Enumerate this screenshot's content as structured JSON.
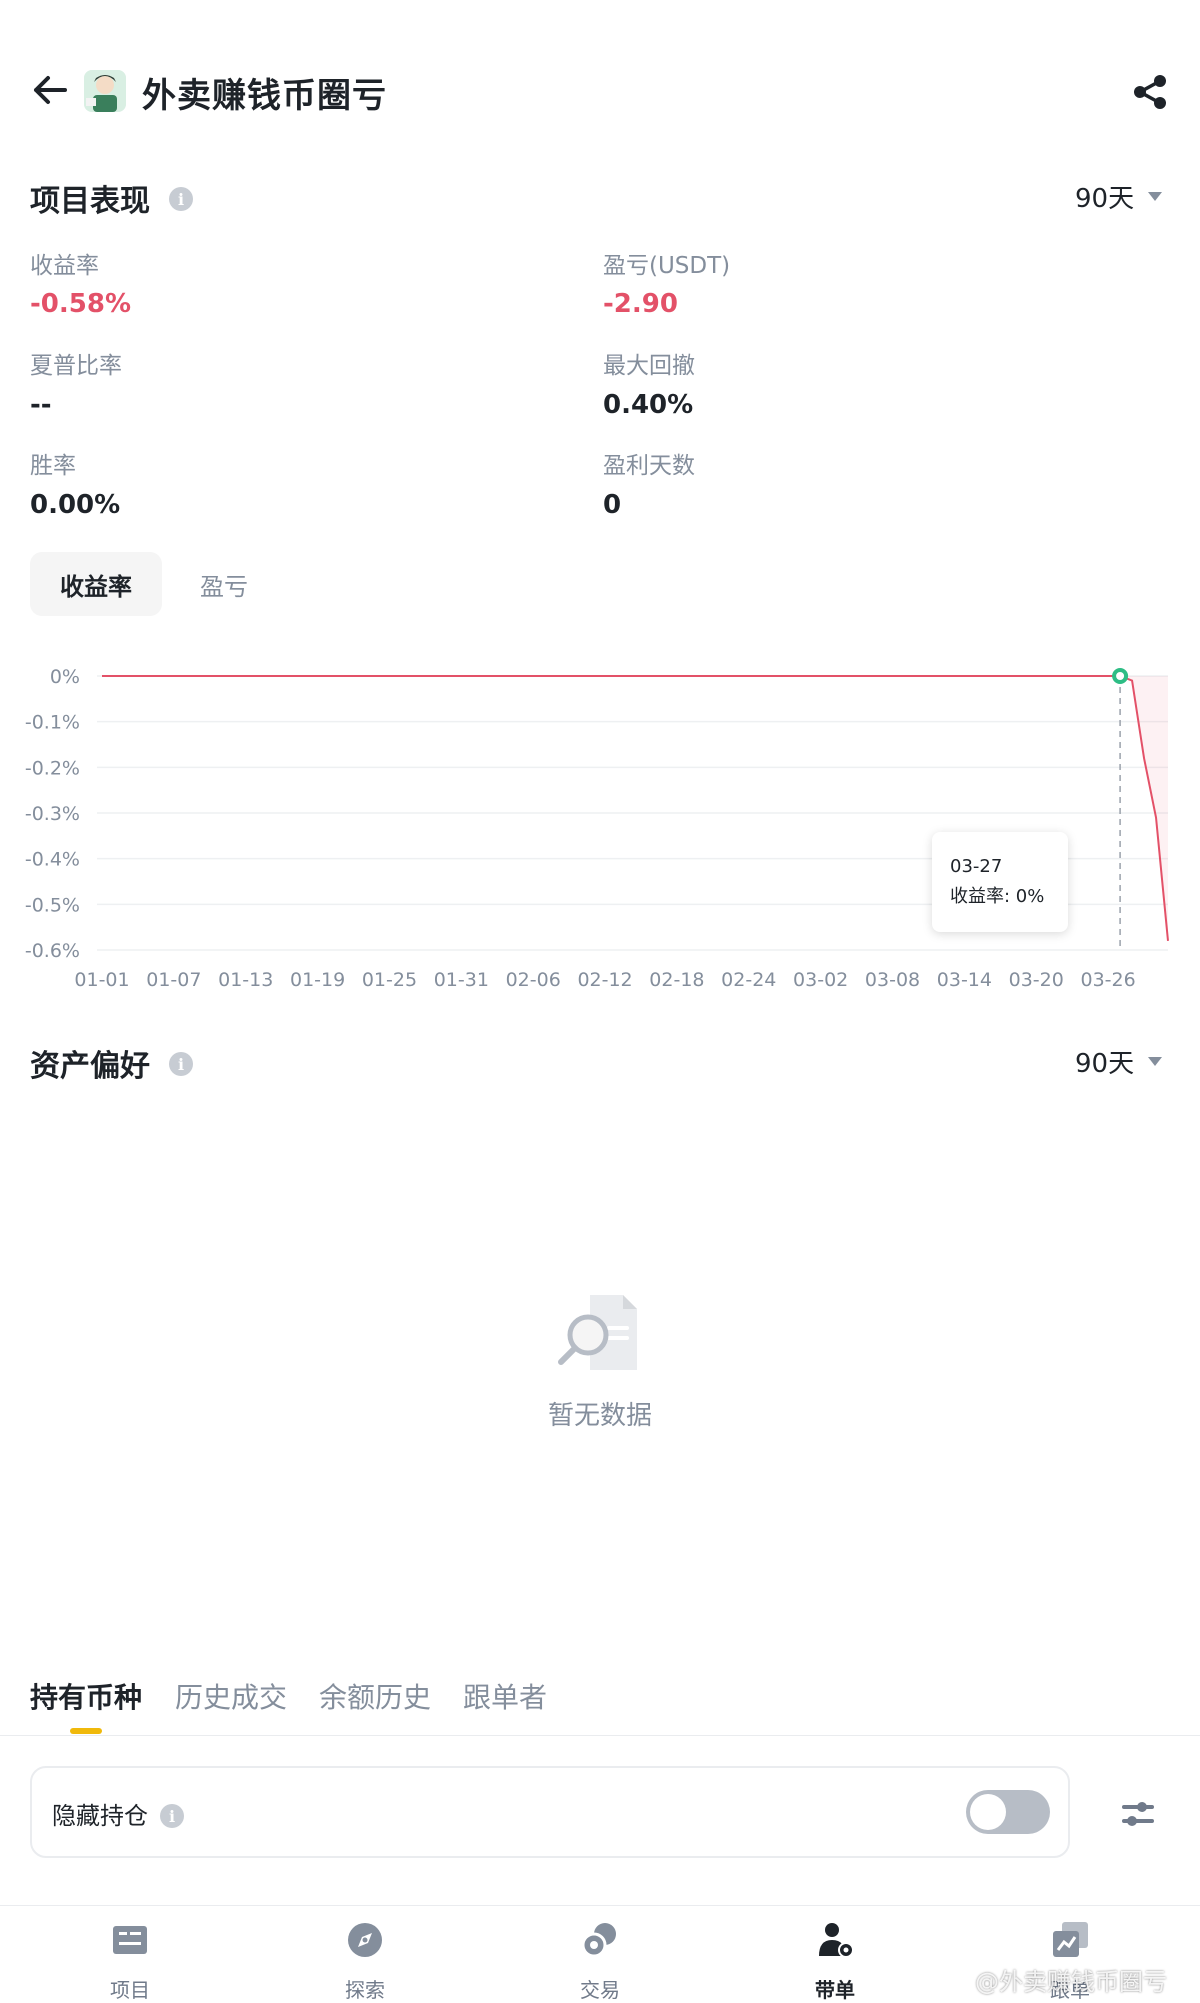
{
  "header": {
    "title": "外卖赚钱币圈亏",
    "back_icon": "arrow-left-icon",
    "share_icon": "share-icon"
  },
  "performance": {
    "title": "项目表现",
    "period": "90天",
    "metrics": [
      {
        "label": "收益率",
        "value": "-0.58%",
        "negative": true
      },
      {
        "label": "盈亏(USDT)",
        "value": "-2.90",
        "negative": true
      },
      {
        "label": "夏普比率",
        "value": "--",
        "negative": false
      },
      {
        "label": "最大回撤",
        "value": "0.40%",
        "negative": false
      },
      {
        "label": "胜率",
        "value": "0.00%",
        "negative": false
      },
      {
        "label": "盈利天数",
        "value": "0",
        "negative": false
      }
    ],
    "chips": {
      "active": "收益率",
      "inactive": "盈亏"
    }
  },
  "chart_data": {
    "type": "line",
    "title": "",
    "xlabel": "",
    "ylabel": "",
    "y_ticks": [
      "0%",
      "-0.1%",
      "-0.2%",
      "-0.3%",
      "-0.4%",
      "-0.5%",
      "-0.6%"
    ],
    "ylim": [
      -0.6,
      0
    ],
    "x_tick_labels": [
      "01-01",
      "01-07",
      "01-13",
      "01-19",
      "01-25",
      "01-31",
      "02-06",
      "02-12",
      "02-18",
      "02-24",
      "03-02",
      "03-08",
      "03-14",
      "03-20",
      "03-26"
    ],
    "x_range_days": [
      0,
      89
    ],
    "series": [
      {
        "values_x_days": [
          0,
          85,
          86,
          87,
          88,
          89
        ],
        "values_y": [
          0,
          0,
          -0.01,
          -0.18,
          -0.31,
          -0.58
        ],
        "color": "#e35168"
      }
    ],
    "highlight": {
      "x_day": 85,
      "date": "03-27",
      "label": "收益率: 0%",
      "marker_color": "#2ebd85"
    },
    "grid": true,
    "legend": "none"
  },
  "tooltip": {
    "date": "03-27",
    "text": "收益率: 0%"
  },
  "asset_pref": {
    "title": "资产偏好",
    "period": "90天",
    "empty_text": "暂无数据",
    "empty_icon": "search-document-icon"
  },
  "tabs": [
    "持有币种",
    "历史成交",
    "余额历史",
    "跟单者"
  ],
  "holdings": {
    "hide_label": "隐藏持仓",
    "toggle_on": false,
    "filter_icon": "sliders-icon"
  },
  "nav": [
    {
      "label": "项目",
      "icon": "projects-icon",
      "active": false
    },
    {
      "label": "探索",
      "icon": "compass-icon",
      "active": false
    },
    {
      "label": "交易",
      "icon": "trade-icon",
      "active": false
    },
    {
      "label": "带单",
      "icon": "lead-trader-icon",
      "active": true
    },
    {
      "label": "跟单",
      "icon": "copy-trade-icon",
      "active": false
    }
  ],
  "watermark": "@外卖赚钱币圈亏"
}
